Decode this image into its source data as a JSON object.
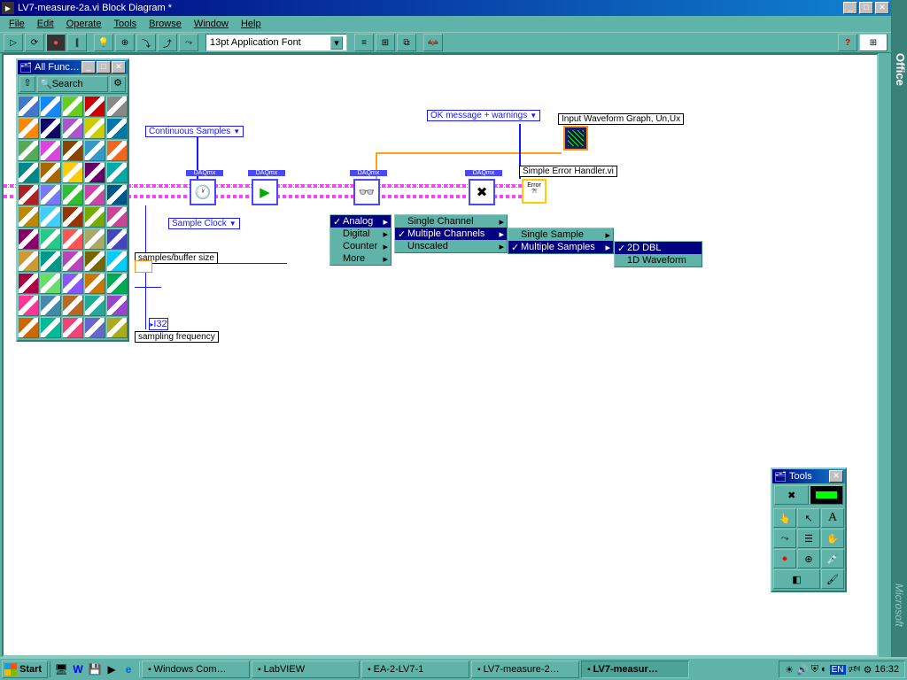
{
  "title": "LV7-measure-2a.vi Block Diagram *",
  "menu": [
    "File",
    "Edit",
    "Operate",
    "Tools",
    "Browse",
    "Window",
    "Help"
  ],
  "font": "13pt Application Font",
  "palette_title": "All Func…",
  "palette_search": "Search",
  "tools_title": "Tools",
  "diagram": {
    "continuous": "Continuous Samples",
    "sample_clock": "Sample Clock",
    "buffer": "samples/buffer size",
    "sampling": "sampling frequency",
    "ok_msg": "OK message + warnings",
    "graph": "Input Waveform Graph, Un,Ux",
    "errh": "Simple Error Handler.vi",
    "i32": "I32"
  },
  "context": {
    "m1": [
      {
        "t": "Analog",
        "chk": true,
        "arr": true,
        "hl": true
      },
      {
        "t": "Digital",
        "arr": true
      },
      {
        "t": "Counter",
        "arr": true
      },
      {
        "t": "More",
        "arr": true
      }
    ],
    "m2": [
      {
        "t": "Single Channel",
        "arr": true
      },
      {
        "t": "Multiple Channels",
        "chk": true,
        "arr": true,
        "hl": true
      },
      {
        "t": "Unscaled",
        "arr": true
      }
    ],
    "m3": [
      {
        "t": "Single Sample",
        "arr": true
      },
      {
        "t": "Multiple Samples",
        "chk": true,
        "arr": true,
        "hl": true
      }
    ],
    "m4": [
      {
        "t": "2D DBL",
        "chk": true,
        "hl": true
      },
      {
        "t": "1D Waveform"
      }
    ]
  },
  "office_label": "Office",
  "ms_label": "Microsoft",
  "taskbar": {
    "start": "Start",
    "tasks": [
      {
        "label": "Windows Com…"
      },
      {
        "label": "LabVIEW"
      },
      {
        "label": "EA-2-LV7-1"
      },
      {
        "label": "LV7-measure-2…"
      },
      {
        "label": "LV7-measur…",
        "active": true
      }
    ],
    "lang": "EN",
    "clock": "16:32"
  }
}
